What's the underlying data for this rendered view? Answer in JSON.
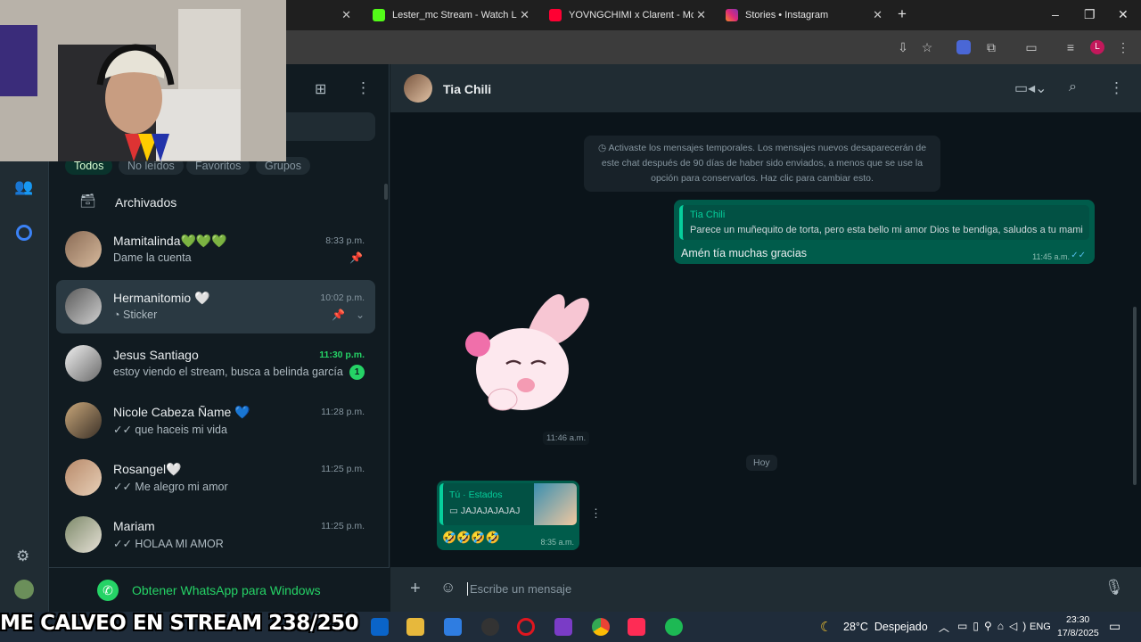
{
  "browser": {
    "tabs": [
      {
        "title": "Lester_mc Stream - Watch Live",
        "color": "#53fc18"
      },
      {
        "title": "YOVNGCHIMI x Clarent - Mclar",
        "color": "#ff0033"
      },
      {
        "title": "Stories • Instagram",
        "color": "#d6249f"
      }
    ],
    "profile_initial": "L"
  },
  "chatlist": {
    "filters": [
      "Todos",
      "No leídos",
      "Favoritos",
      "Grupos"
    ],
    "archived_label": "Archivados",
    "chats": [
      {
        "name": "Mamitalinda💚💚💚",
        "message": "Dame la cuenta",
        "time": "8:33 p.m.",
        "pinned": true
      },
      {
        "name": "Hermanitomio 🤍",
        "message": "Sticker",
        "time": "10:02 p.m.",
        "pinned": true
      },
      {
        "name": "Jesus Santiago",
        "message": "estoy viendo el stream, busca a belinda garcía",
        "time": "11:30 p.m.",
        "unread": "1"
      },
      {
        "name": "Nicole Cabeza Ñame 💙",
        "message": "que haceis mi vida",
        "time": "11:28 p.m."
      },
      {
        "name": "Rosangel🤍",
        "message": "Me alegro mi amor",
        "time": "11:25 p.m."
      },
      {
        "name": "Mariam",
        "message": "HOLAA MI AMOR",
        "time": "11:25 p.m."
      }
    ],
    "get_app": "Obtener WhatsApp para Windows"
  },
  "chat": {
    "contact": "Tia Chili",
    "system_notice": "Activaste los mensajes temporales. Los mensajes nuevos desaparecerán de este chat después de 90 días de haber sido enviados, a menos que se use la opción para conservarlos. Haz clic para cambiar esto.",
    "reply_quote_author": "Tia Chili",
    "reply_quote_text": "Parece un muñequito de torta, pero esta bello  mi amor Dios te bendiga, saludos a tu mami",
    "reply_text": "Amén tía muchas gracias",
    "reply_time": "11:45 a.m.",
    "sticker_time": "11:46 a.m.",
    "day_divider": "Hoy",
    "status_reply_label": "Tú · Estados",
    "status_reply_text": "JAJAJAJAJAJ",
    "status_message": "🤣🤣🤣🤣",
    "status_time": "8:35 a.m.",
    "composer_placeholder": "Escribe un mensaje"
  },
  "taskbar": {
    "weather": "28°C  Despejado",
    "lang": "ENG",
    "time": "23:30",
    "date": "17/8/2025"
  },
  "overlay": "ME CALVEO EN STREAM 238/250",
  "colors": {
    "accent": "#25d366",
    "outgoing": "#005c4b",
    "header": "#202c33"
  }
}
